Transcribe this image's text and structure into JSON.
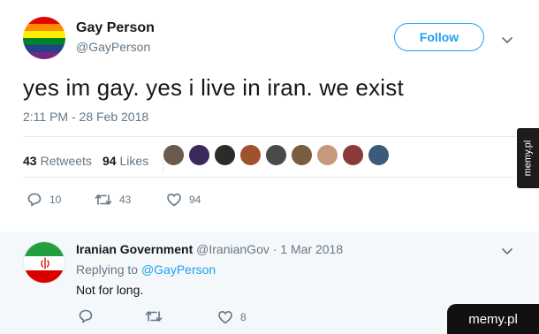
{
  "tweet": {
    "author_name": "Gay Person",
    "author_handle": "@GayPerson",
    "follow_label": "Follow",
    "text": "yes im gay. yes i live in iran. we exist",
    "timestamp": "2:11 PM - 28 Feb 2018",
    "retweets_count": "43",
    "retweets_label": "Retweets",
    "likes_count": "94",
    "likes_label": "Likes",
    "actions": {
      "replies": "10",
      "retweets": "43",
      "likes": "94"
    },
    "avatar_colors": [
      "#e40303",
      "#ff8c00",
      "#ffed00",
      "#008026",
      "#24408e",
      "#732982"
    ],
    "liker_colors": [
      "#6b5a4e",
      "#3a2a5c",
      "#2b2b2b",
      "#a0522d",
      "#4a4a4a",
      "#7a5c40",
      "#c49a7a",
      "#8b3a3a",
      "#3c5a7a"
    ]
  },
  "reply": {
    "author_name": "Iranian Government",
    "author_handle": "@IranianGov",
    "date": "· 1 Mar 2018",
    "replying_prefix": "Replying to",
    "replying_handle": "@GayPerson",
    "text": "Not for long.",
    "likes": "8",
    "flag_colors": [
      "#239f40",
      "#ffffff",
      "#da0000"
    ]
  },
  "watermarks": {
    "side": "memy.pl",
    "corner": "memy.pl"
  }
}
